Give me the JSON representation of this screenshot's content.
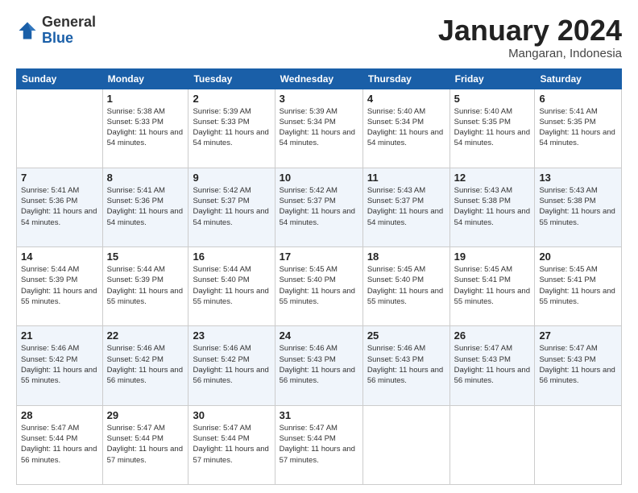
{
  "header": {
    "logo_general": "General",
    "logo_blue": "Blue",
    "month_title": "January 2024",
    "location": "Mangaran, Indonesia"
  },
  "days_of_week": [
    "Sunday",
    "Monday",
    "Tuesday",
    "Wednesday",
    "Thursday",
    "Friday",
    "Saturday"
  ],
  "weeks": [
    [
      {
        "day": "",
        "sunrise": "",
        "sunset": "",
        "daylight": ""
      },
      {
        "day": "1",
        "sunrise": "Sunrise: 5:38 AM",
        "sunset": "Sunset: 5:33 PM",
        "daylight": "Daylight: 11 hours and 54 minutes."
      },
      {
        "day": "2",
        "sunrise": "Sunrise: 5:39 AM",
        "sunset": "Sunset: 5:33 PM",
        "daylight": "Daylight: 11 hours and 54 minutes."
      },
      {
        "day": "3",
        "sunrise": "Sunrise: 5:39 AM",
        "sunset": "Sunset: 5:34 PM",
        "daylight": "Daylight: 11 hours and 54 minutes."
      },
      {
        "day": "4",
        "sunrise": "Sunrise: 5:40 AM",
        "sunset": "Sunset: 5:34 PM",
        "daylight": "Daylight: 11 hours and 54 minutes."
      },
      {
        "day": "5",
        "sunrise": "Sunrise: 5:40 AM",
        "sunset": "Sunset: 5:35 PM",
        "daylight": "Daylight: 11 hours and 54 minutes."
      },
      {
        "day": "6",
        "sunrise": "Sunrise: 5:41 AM",
        "sunset": "Sunset: 5:35 PM",
        "daylight": "Daylight: 11 hours and 54 minutes."
      }
    ],
    [
      {
        "day": "7",
        "sunrise": "Sunrise: 5:41 AM",
        "sunset": "Sunset: 5:36 PM",
        "daylight": "Daylight: 11 hours and 54 minutes."
      },
      {
        "day": "8",
        "sunrise": "Sunrise: 5:41 AM",
        "sunset": "Sunset: 5:36 PM",
        "daylight": "Daylight: 11 hours and 54 minutes."
      },
      {
        "day": "9",
        "sunrise": "Sunrise: 5:42 AM",
        "sunset": "Sunset: 5:37 PM",
        "daylight": "Daylight: 11 hours and 54 minutes."
      },
      {
        "day": "10",
        "sunrise": "Sunrise: 5:42 AM",
        "sunset": "Sunset: 5:37 PM",
        "daylight": "Daylight: 11 hours and 54 minutes."
      },
      {
        "day": "11",
        "sunrise": "Sunrise: 5:43 AM",
        "sunset": "Sunset: 5:37 PM",
        "daylight": "Daylight: 11 hours and 54 minutes."
      },
      {
        "day": "12",
        "sunrise": "Sunrise: 5:43 AM",
        "sunset": "Sunset: 5:38 PM",
        "daylight": "Daylight: 11 hours and 54 minutes."
      },
      {
        "day": "13",
        "sunrise": "Sunrise: 5:43 AM",
        "sunset": "Sunset: 5:38 PM",
        "daylight": "Daylight: 11 hours and 55 minutes."
      }
    ],
    [
      {
        "day": "14",
        "sunrise": "Sunrise: 5:44 AM",
        "sunset": "Sunset: 5:39 PM",
        "daylight": "Daylight: 11 hours and 55 minutes."
      },
      {
        "day": "15",
        "sunrise": "Sunrise: 5:44 AM",
        "sunset": "Sunset: 5:39 PM",
        "daylight": "Daylight: 11 hours and 55 minutes."
      },
      {
        "day": "16",
        "sunrise": "Sunrise: 5:44 AM",
        "sunset": "Sunset: 5:40 PM",
        "daylight": "Daylight: 11 hours and 55 minutes."
      },
      {
        "day": "17",
        "sunrise": "Sunrise: 5:45 AM",
        "sunset": "Sunset: 5:40 PM",
        "daylight": "Daylight: 11 hours and 55 minutes."
      },
      {
        "day": "18",
        "sunrise": "Sunrise: 5:45 AM",
        "sunset": "Sunset: 5:40 PM",
        "daylight": "Daylight: 11 hours and 55 minutes."
      },
      {
        "day": "19",
        "sunrise": "Sunrise: 5:45 AM",
        "sunset": "Sunset: 5:41 PM",
        "daylight": "Daylight: 11 hours and 55 minutes."
      },
      {
        "day": "20",
        "sunrise": "Sunrise: 5:45 AM",
        "sunset": "Sunset: 5:41 PM",
        "daylight": "Daylight: 11 hours and 55 minutes."
      }
    ],
    [
      {
        "day": "21",
        "sunrise": "Sunrise: 5:46 AM",
        "sunset": "Sunset: 5:42 PM",
        "daylight": "Daylight: 11 hours and 55 minutes."
      },
      {
        "day": "22",
        "sunrise": "Sunrise: 5:46 AM",
        "sunset": "Sunset: 5:42 PM",
        "daylight": "Daylight: 11 hours and 56 minutes."
      },
      {
        "day": "23",
        "sunrise": "Sunrise: 5:46 AM",
        "sunset": "Sunset: 5:42 PM",
        "daylight": "Daylight: 11 hours and 56 minutes."
      },
      {
        "day": "24",
        "sunrise": "Sunrise: 5:46 AM",
        "sunset": "Sunset: 5:43 PM",
        "daylight": "Daylight: 11 hours and 56 minutes."
      },
      {
        "day": "25",
        "sunrise": "Sunrise: 5:46 AM",
        "sunset": "Sunset: 5:43 PM",
        "daylight": "Daylight: 11 hours and 56 minutes."
      },
      {
        "day": "26",
        "sunrise": "Sunrise: 5:47 AM",
        "sunset": "Sunset: 5:43 PM",
        "daylight": "Daylight: 11 hours and 56 minutes."
      },
      {
        "day": "27",
        "sunrise": "Sunrise: 5:47 AM",
        "sunset": "Sunset: 5:43 PM",
        "daylight": "Daylight: 11 hours and 56 minutes."
      }
    ],
    [
      {
        "day": "28",
        "sunrise": "Sunrise: 5:47 AM",
        "sunset": "Sunset: 5:44 PM",
        "daylight": "Daylight: 11 hours and 56 minutes."
      },
      {
        "day": "29",
        "sunrise": "Sunrise: 5:47 AM",
        "sunset": "Sunset: 5:44 PM",
        "daylight": "Daylight: 11 hours and 57 minutes."
      },
      {
        "day": "30",
        "sunrise": "Sunrise: 5:47 AM",
        "sunset": "Sunset: 5:44 PM",
        "daylight": "Daylight: 11 hours and 57 minutes."
      },
      {
        "day": "31",
        "sunrise": "Sunrise: 5:47 AM",
        "sunset": "Sunset: 5:44 PM",
        "daylight": "Daylight: 11 hours and 57 minutes."
      },
      {
        "day": "",
        "sunrise": "",
        "sunset": "",
        "daylight": ""
      },
      {
        "day": "",
        "sunrise": "",
        "sunset": "",
        "daylight": ""
      },
      {
        "day": "",
        "sunrise": "",
        "sunset": "",
        "daylight": ""
      }
    ]
  ]
}
